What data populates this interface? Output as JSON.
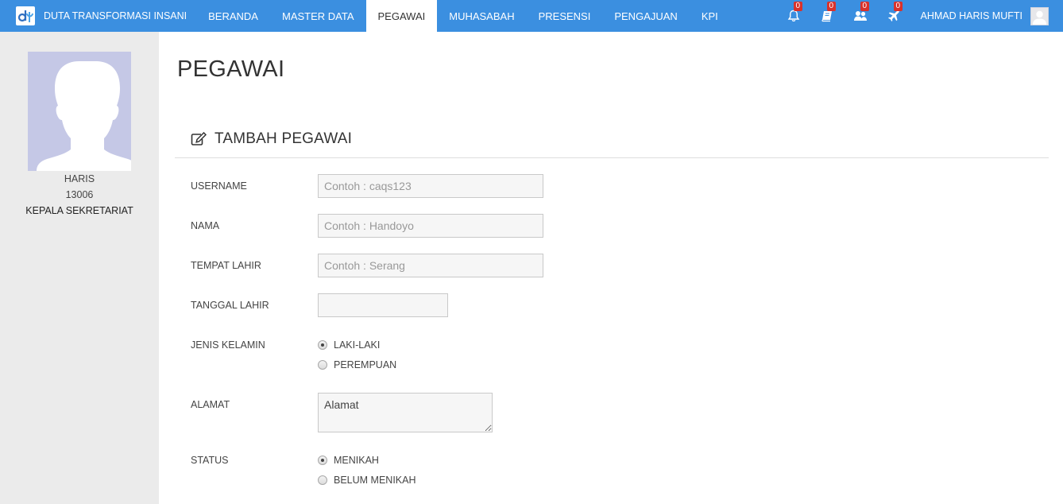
{
  "brand": {
    "name": "DUTA TRANSFORMASI INSANI",
    "logo_icon": "dti-logo-icon"
  },
  "nav": {
    "items": [
      {
        "label": "BERANDA"
      },
      {
        "label": "MASTER DATA"
      },
      {
        "label": "PEGAWAI",
        "active": true
      },
      {
        "label": "MUHASABAH"
      },
      {
        "label": "PRESENSI"
      },
      {
        "label": "PENGAJUAN"
      },
      {
        "label": "KPI"
      }
    ],
    "notifications": [
      {
        "icon": "bell-icon",
        "count": "0"
      },
      {
        "icon": "book-icon",
        "count": "0"
      },
      {
        "icon": "users-icon",
        "count": "0"
      },
      {
        "icon": "plane-icon",
        "count": "0"
      }
    ],
    "user": {
      "name": "AHMAD HARIS MUFTI"
    },
    "accent_color": "#3b8fe0",
    "badge_color": "#d9312b"
  },
  "sidebar": {
    "name": "HARIS",
    "id": "13006",
    "role": "KEPALA SEKRETARIAT"
  },
  "main": {
    "page_title": "PEGAWAI",
    "section_title": "TAMBAH PEGAWAI",
    "section_icon": "edit-icon",
    "form": {
      "username": {
        "label": "USERNAME",
        "placeholder": "Contoh : caqs123",
        "value": ""
      },
      "nama": {
        "label": "NAMA",
        "placeholder": "Contoh : Handoyo",
        "value": ""
      },
      "tempat_lahir": {
        "label": "TEMPAT LAHIR",
        "placeholder": "Contoh : Serang",
        "value": ""
      },
      "tanggal_lahir": {
        "label": "TANGGAL LAHIR",
        "value": ""
      },
      "jenis_kelamin": {
        "label": "JENIS KELAMIN",
        "options": [
          "LAKI-LAKI",
          "PEREMPUAN"
        ],
        "selected": "LAKI-LAKI"
      },
      "alamat": {
        "label": "ALAMAT",
        "placeholder": "Alamat",
        "value": ""
      },
      "status": {
        "label": "STATUS",
        "options": [
          "MENIKAH",
          "BELUM MENIKAH"
        ],
        "selected": "MENIKAH"
      }
    }
  }
}
